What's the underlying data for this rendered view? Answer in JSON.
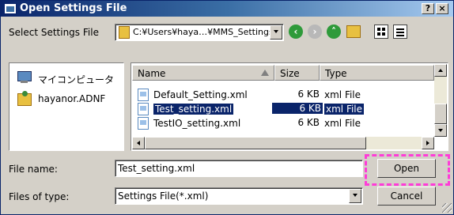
{
  "window": {
    "title": "Open Settings File",
    "help_label": "?",
    "close_label": "×"
  },
  "location": {
    "label": "Select Settings File",
    "path": "C:¥Users¥haya…¥MMS_Settings"
  },
  "toolbar": {
    "back_icon": "back-icon",
    "forward_icon": "forward-icon",
    "up_icon": "up-folder-icon",
    "new_folder_icon": "new-folder-icon",
    "view_icon": "view-mode-icon",
    "details_icon": "details-view-icon"
  },
  "places": [
    {
      "label": "マイコンピュータ",
      "icon": "computer-icon"
    },
    {
      "label": "hayanor.ADNF",
      "icon": "user-folder-icon"
    }
  ],
  "columns": {
    "name": "Name",
    "size": "Size",
    "type": "Type"
  },
  "files": [
    {
      "name": "Default_Setting.xml",
      "size": "6 KB",
      "type": "xml File",
      "selected": false
    },
    {
      "name": "Test_setting.xml",
      "size": "6 KB",
      "type": "xml File",
      "selected": true
    },
    {
      "name": "TestIO_setting.xml",
      "size": "6 KB",
      "type": "xml File",
      "selected": false
    }
  ],
  "filename": {
    "label": "File name:",
    "value": "Test_setting.xml"
  },
  "filetype": {
    "label": "Files of type:",
    "value": "Settings File(*.xml)"
  },
  "buttons": {
    "open": "Open",
    "cancel": "Cancel"
  },
  "colors": {
    "title_start": "#0a246a",
    "title_end": "#a6caf0",
    "selection": "#0a246a",
    "highlight_border": "#ff3bd8",
    "nav_green": "#2e9a3a"
  }
}
